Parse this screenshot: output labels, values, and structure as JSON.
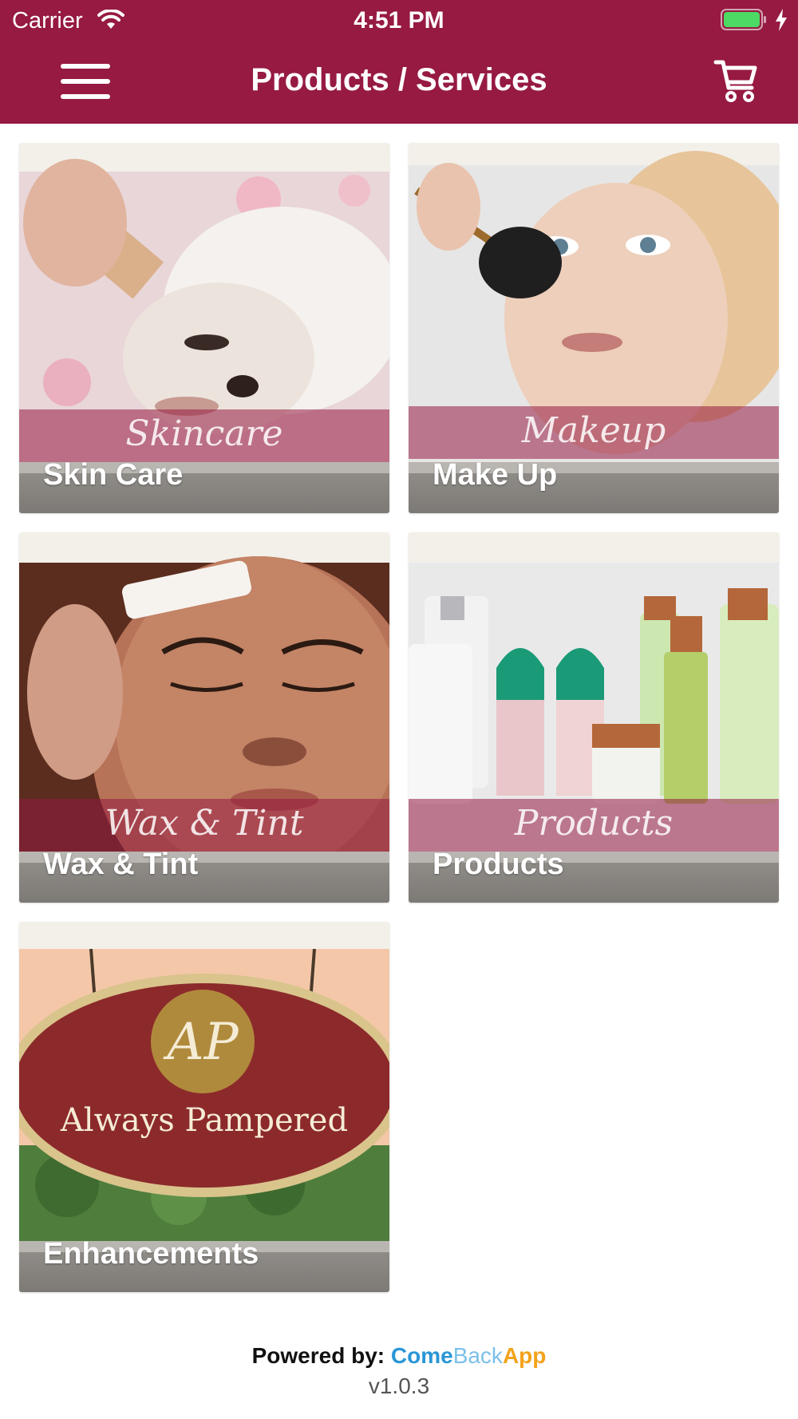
{
  "status_bar": {
    "carrier": "Carrier",
    "time": "4:51 PM",
    "icons": [
      "wifi-icon",
      "battery-icon",
      "charging-bolt-icon"
    ]
  },
  "nav": {
    "title": "Products / Services",
    "menu_icon": "hamburger-menu-icon",
    "cart_icon": "shopping-cart-icon"
  },
  "tiles": [
    {
      "label": "Skin Care",
      "band_text": "Skincare"
    },
    {
      "label": "Make Up",
      "band_text": "Makeup"
    },
    {
      "label": "Wax & Tint",
      "band_text": "Wax & Tint"
    },
    {
      "label": "Products",
      "band_text": "Products"
    },
    {
      "label": "Enhancements",
      "sign_text": "Always Pampered",
      "sign_monogram": "AP"
    }
  ],
  "footer": {
    "powered_label": "Powered by:",
    "brand_come": "Come",
    "brand_back": "Back",
    "brand_app": "App",
    "version": "v1.0.3"
  },
  "colors": {
    "header": "#961a42",
    "brand_come": "#2a96d6",
    "brand_back": "#7cc0e8",
    "brand_app": "#f3a21a"
  }
}
